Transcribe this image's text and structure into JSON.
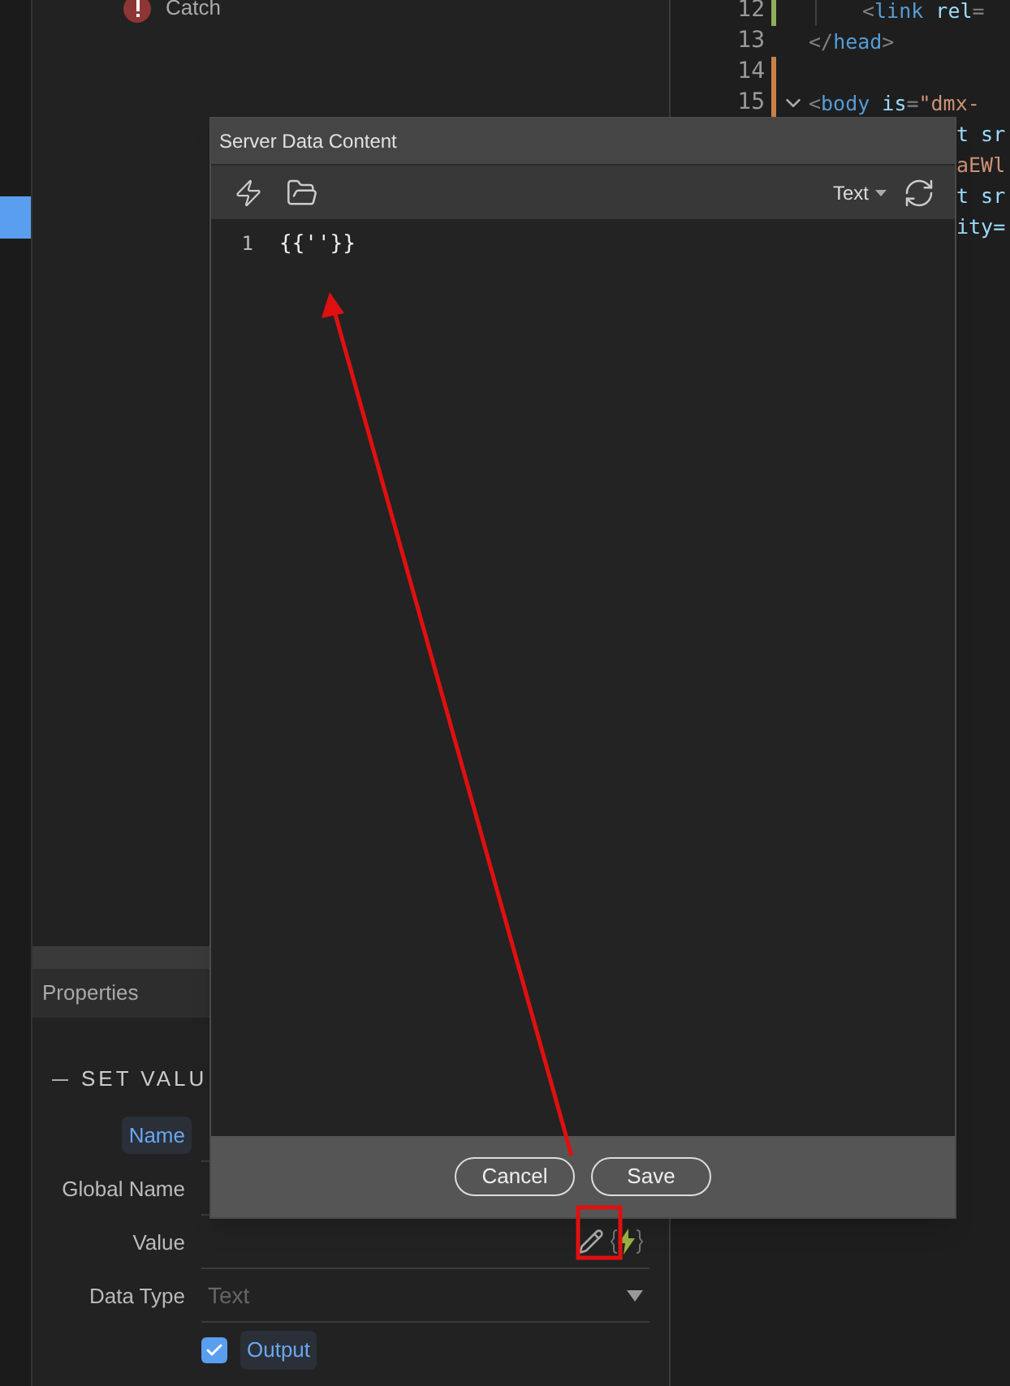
{
  "left_panel": {
    "items": [
      {
        "label": "Catch",
        "kind": "error"
      }
    ]
  },
  "code_editor": {
    "lines": [
      {
        "number": "12",
        "color": "#8fae5a",
        "fold": false,
        "indent": true,
        "tokens": [
          {
            "kind": "punct",
            "text": "<"
          },
          {
            "kind": "tag",
            "text": "link"
          },
          {
            "kind": "attr",
            "text": " rel"
          },
          {
            "kind": "punct",
            "text": "="
          }
        ]
      },
      {
        "number": "13",
        "fold": false,
        "indent": false,
        "tokens": [
          {
            "kind": "punct",
            "text": "</"
          },
          {
            "kind": "tag",
            "text": "head"
          },
          {
            "kind": "punct",
            "text": ">"
          }
        ]
      },
      {
        "number": "14",
        "color": "#c7814a",
        "fold": false,
        "indent": false
      },
      {
        "number": "15",
        "color": "#c7814a",
        "fold": true,
        "indent": false,
        "tokens": [
          {
            "kind": "punct",
            "text": "<"
          },
          {
            "kind": "tag",
            "text": "body"
          },
          {
            "kind": "attr",
            "text": " is"
          },
          {
            "kind": "punct",
            "text": "="
          },
          {
            "kind": "string",
            "text": "\"dmx-"
          }
        ]
      }
    ],
    "fragments": [
      {
        "kind": "attr",
        "text": "t sr"
      },
      {
        "kind": "string",
        "text": "aEWl"
      },
      {
        "kind": "attr",
        "text": "t sr"
      },
      {
        "kind": "attr",
        "text": "ity="
      }
    ]
  },
  "dialog": {
    "title": "Server Data Content",
    "mode": "Text",
    "lines": [
      {
        "number": "1",
        "text": "{{''}}"
      }
    ],
    "buttons": [
      "Cancel",
      "Save"
    ]
  },
  "properties": {
    "title": "Properties",
    "section": "SET VALU",
    "fields": [
      {
        "label": "Name",
        "kind": "text",
        "highlighted": true
      },
      {
        "label": "Global Name",
        "kind": "text",
        "highlighted": false
      },
      {
        "label": "Value",
        "kind": "value",
        "highlighted": false
      },
      {
        "label": "Data Type",
        "kind": "select",
        "placeholder": "Text",
        "highlighted": false
      }
    ],
    "checkbox": {
      "label": "Output",
      "checked": true
    }
  }
}
